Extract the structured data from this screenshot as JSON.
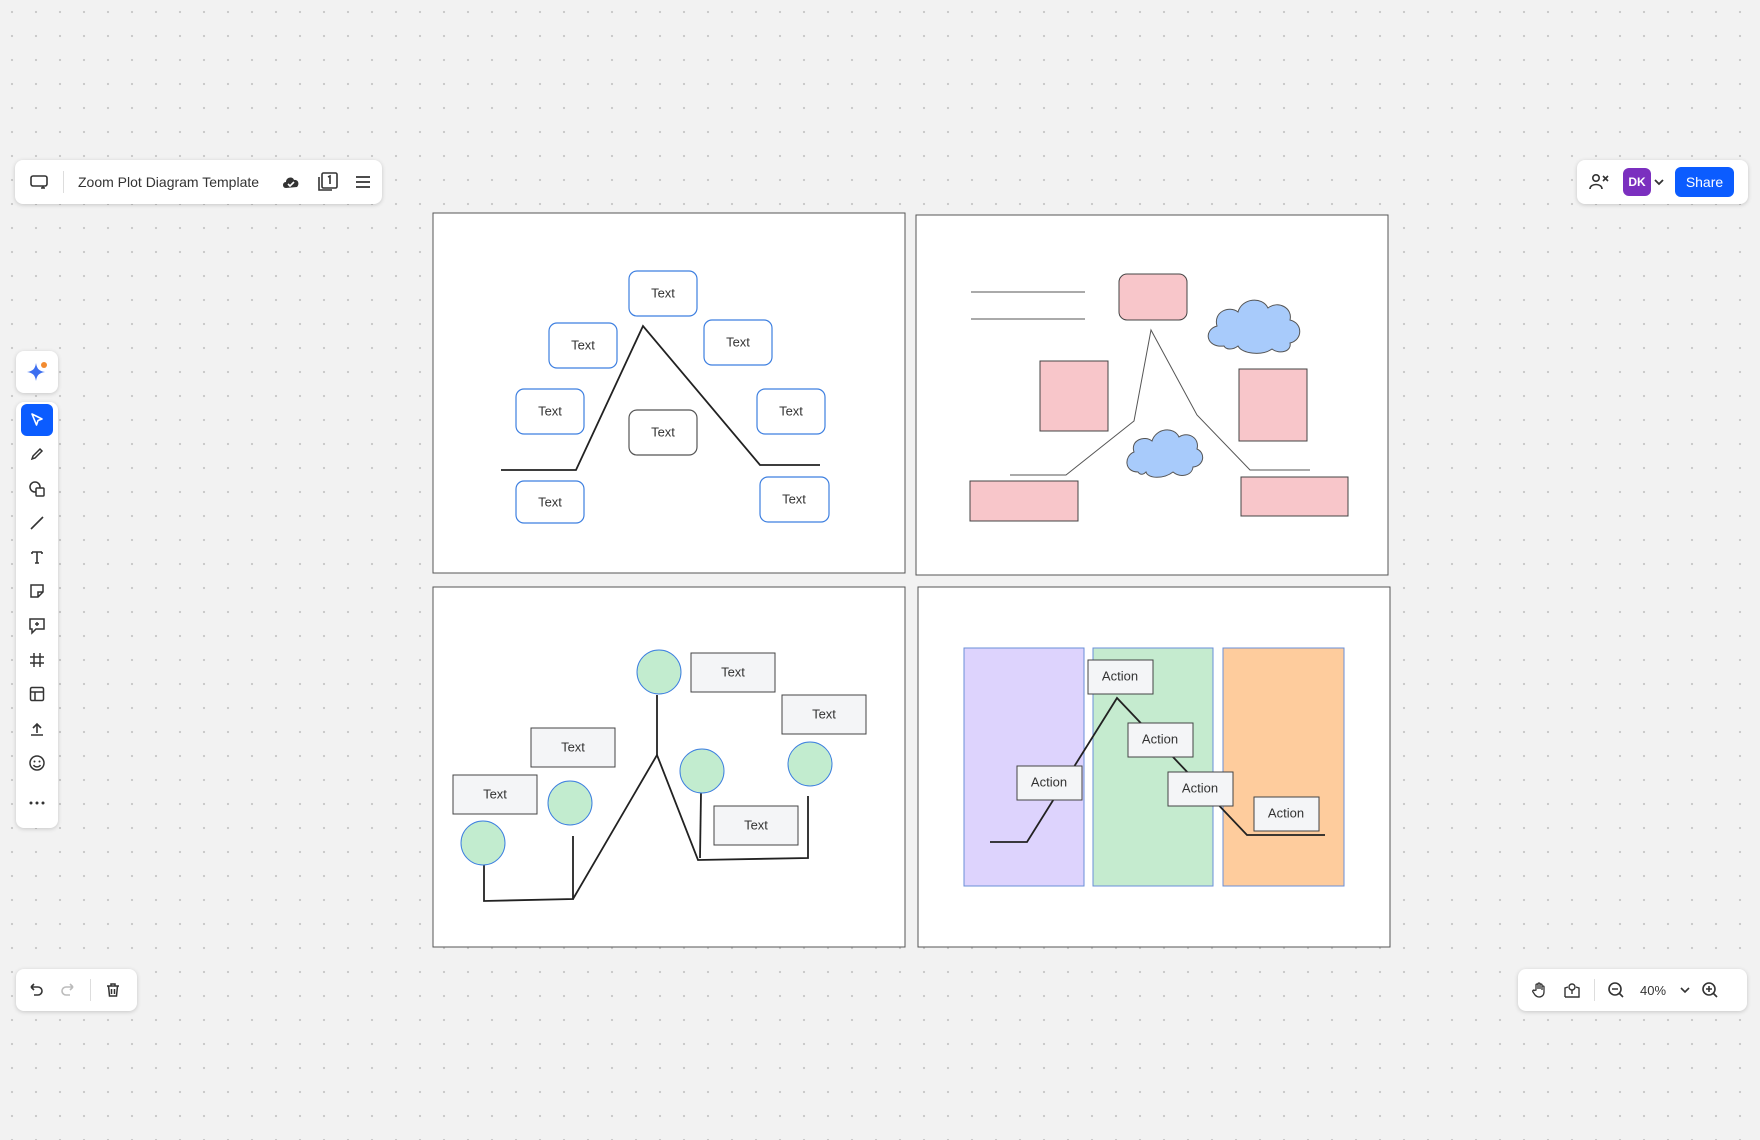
{
  "document": {
    "title": "Zoom Plot Diagram Template"
  },
  "user": {
    "initials": "DK",
    "color": "#7b2fbf"
  },
  "share": {
    "label": "Share"
  },
  "zoom": {
    "level": "40%"
  },
  "frames": {
    "frame1": {
      "labels": [
        "Text",
        "Text",
        "Text",
        "Text",
        "Text",
        "Text",
        "Text",
        "Text"
      ]
    },
    "frame3": {
      "labels": [
        "Text",
        "Text",
        "Text",
        "Text",
        "Text"
      ]
    },
    "frame4": {
      "labels": [
        "Action",
        "Action",
        "Action",
        "Action",
        "Action"
      ],
      "column_colors": [
        "#ddd3fd",
        "#c5ebcf",
        "#fecc9d"
      ]
    }
  },
  "colors": {
    "accent": "#0b5cff",
    "pink": "#f8c6ca",
    "cloud": "#a8cbfb",
    "green_circle": "#c2eccf"
  },
  "icons": {
    "top_left": [
      "whiteboard-icon",
      "cloud-saved-icon",
      "pages-icon",
      "menu-icon"
    ],
    "toolbar": [
      "select-icon",
      "pen-icon",
      "shapes-icon",
      "line-icon",
      "text-icon",
      "sticky-note-icon",
      "comment-icon",
      "frame-icon",
      "template-icon",
      "upload-icon",
      "emoji-icon",
      "more-icon"
    ]
  }
}
